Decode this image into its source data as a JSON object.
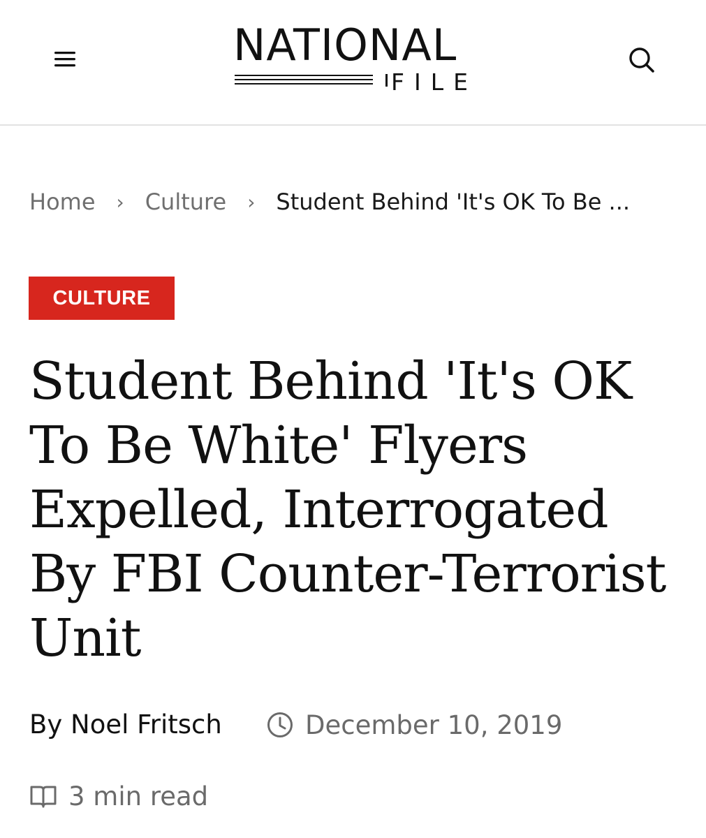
{
  "header": {
    "menu_icon": "hamburger-menu-icon",
    "search_icon": "search-icon",
    "logo": {
      "line1": "NATIONAL",
      "line2": "FILE"
    }
  },
  "breadcrumb": {
    "items": [
      {
        "label": "Home"
      },
      {
        "label": "Culture"
      }
    ],
    "separator": "›",
    "current": "Student Behind 'It's OK To Be ..."
  },
  "article": {
    "category": "CULTURE",
    "category_color": "#d7261e",
    "title": "Student Behind 'It's OK To Be White' Flyers Expelled, Interrogated By FBI Counter-Terrorist Unit",
    "byline_prefix": "By",
    "author": "Noel Fritsch",
    "date_icon": "clock-icon",
    "date": "December 10, 2019",
    "read_time_icon": "open-book-icon",
    "read_time": "3 min read"
  }
}
